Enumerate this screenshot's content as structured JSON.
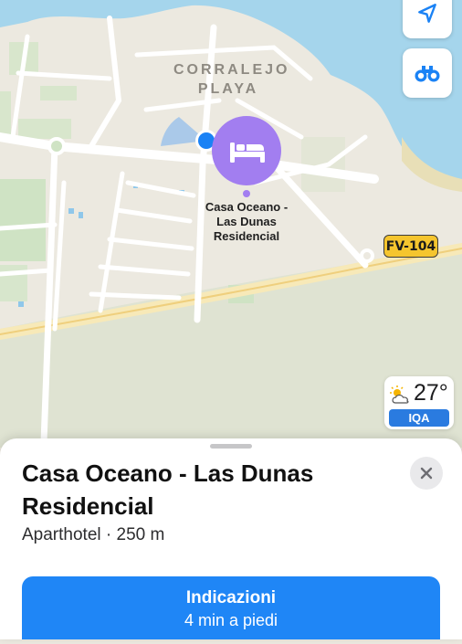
{
  "map": {
    "area_label_line1": "CORRALEJO",
    "area_label_line2": "PLAYA",
    "poi": {
      "label_line1": "Casa Oceano -",
      "label_line2": "Las Dunas",
      "label_line3": "Residencial",
      "icon": "bed-icon",
      "color": "#a27ef0"
    },
    "road_shield": "FV-104",
    "road_shield_color": "#f5c52e",
    "user_location_color": "#1a82f5"
  },
  "controls": {
    "locate_icon": "location-arrow-icon",
    "look_around_icon": "binoculars-icon"
  },
  "weather": {
    "icon": "partly-sunny-icon",
    "temperature": "27°",
    "aqi_label": "IQA"
  },
  "place_card": {
    "title": "Casa Oceano - Las Dunas Residencial",
    "subtitle": "Aparthotel · 250 m",
    "close_icon": "close-icon",
    "directions_label": "Indicazioni",
    "directions_time": "4 min a piedi",
    "accent": "#1f86f6"
  }
}
